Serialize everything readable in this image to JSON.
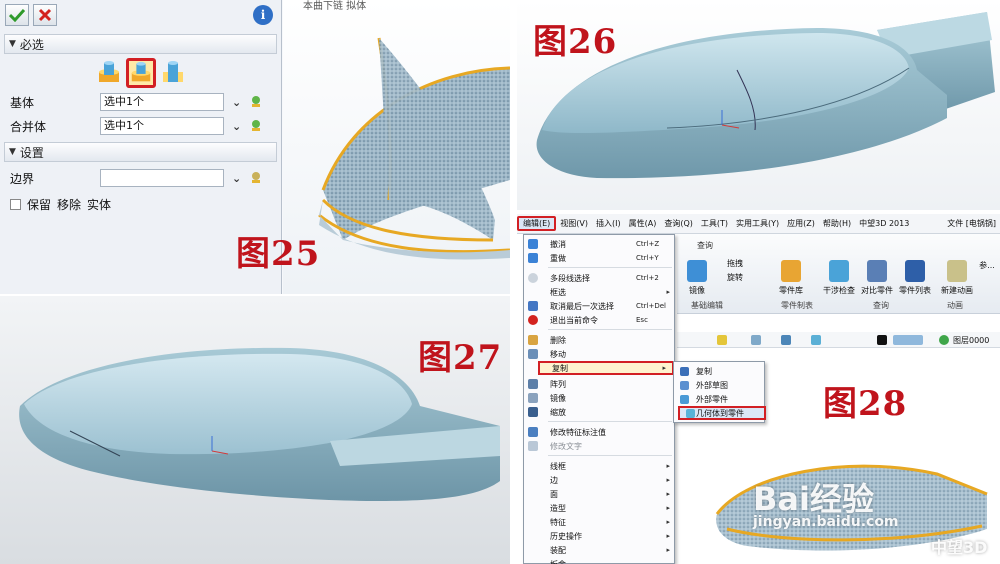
{
  "panels": {
    "p25": {
      "label": "图25",
      "required_section": "必选",
      "base_label": "基体",
      "base_value": "选中1个",
      "merge_label": "合并体",
      "merge_value": "选中1个",
      "settings_section": "设置",
      "boundary_label": "边界",
      "keep_label": "保留",
      "remove_label": "移除",
      "solid_label": "实体",
      "view_caption": "本曲下链 拟体"
    },
    "p26": {
      "label": "图26"
    },
    "p27": {
      "label": "图27"
    },
    "p28": {
      "label": "图28",
      "menubar": {
        "edit": "编辑(E)",
        "view": "视图(V)",
        "insert": "插入(I)",
        "attribute": "属性(A)",
        "query": "查询(Q)",
        "tools": "工具(T)",
        "utility": "实用工具(Y)",
        "application": "应用(Z)",
        "help": "帮助(H)",
        "app_title": "中望3D 2013",
        "file_title": "文件 [电锅锅]"
      },
      "ribbon": {
        "tab_query": "查询",
        "mirror": "镜像",
        "stretch": "拖拽",
        "rotate": "旋转",
        "part_lib": "零件库",
        "interference": "干涉检查",
        "compare": "对比零件",
        "part_list": "零件列表",
        "new_animation": "新建动画",
        "ref": "参...",
        "group_basic": "基础编辑",
        "group_part": "零件制表",
        "group_query": "查询",
        "group_anim": "动画",
        "layer": "图层0000"
      },
      "menu": {
        "undo": "撤消",
        "undo_sc": "Ctrl+Z",
        "redo": "重做",
        "redo_sc": "Ctrl+Y",
        "multi_select": "多段线选择",
        "multi_select_sc": "Ctrl+2",
        "filter": "框选",
        "cancel_select": "取消最后一次选择",
        "cancel_select_sc": "Ctrl+Del",
        "exit_cmd": "退出当前命令",
        "exit_cmd_sc": "Esc",
        "delete": "删除",
        "move": "移动",
        "copy": "复制",
        "array": "阵列",
        "mirror": "镜像",
        "scale": "缩放",
        "modify_feature": "修改特征标注值",
        "modify_text": "修改文字",
        "wireframe": "线框",
        "edge": "边",
        "face": "面",
        "shape": "造型",
        "feature": "特征",
        "history": "历史操作",
        "assembly": "装配",
        "last": "板金"
      },
      "submenu": {
        "copy": "复制",
        "external_sketch": "外部草图",
        "external_part": "外部零件",
        "geometry_to_part": "几何体到零件"
      },
      "watermark_main": "Bai经验",
      "watermark_url": "jingyan.baidu.com",
      "brand": "中望3D"
    }
  }
}
